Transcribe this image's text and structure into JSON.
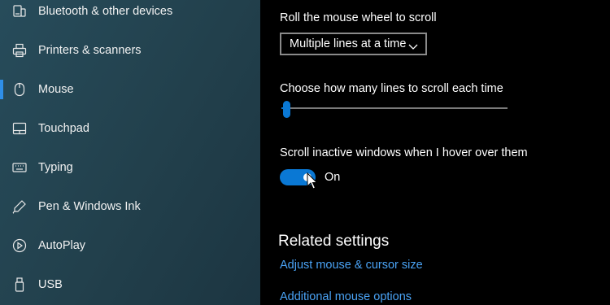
{
  "sidebar": {
    "items": [
      {
        "label": "Bluetooth & other devices",
        "icon": "bluetooth-devices-icon",
        "selected": false
      },
      {
        "label": "Printers & scanners",
        "icon": "printer-icon",
        "selected": false
      },
      {
        "label": "Mouse",
        "icon": "mouse-icon",
        "selected": true
      },
      {
        "label": "Touchpad",
        "icon": "touchpad-icon",
        "selected": false
      },
      {
        "label": "Typing",
        "icon": "keyboard-icon",
        "selected": false
      },
      {
        "label": "Pen & Windows Ink",
        "icon": "pen-icon",
        "selected": false
      },
      {
        "label": "AutoPlay",
        "icon": "autoplay-icon",
        "selected": false
      },
      {
        "label": "USB",
        "icon": "usb-icon",
        "selected": false
      }
    ]
  },
  "main": {
    "scroll_label": "Roll the mouse wheel to scroll",
    "scroll_dropdown_value": "Multiple lines at a time",
    "lines_label": "Choose how many lines to scroll each time",
    "lines_slider_fraction": 0.03,
    "inactive_label": "Scroll inactive windows when I hover over them",
    "inactive_toggle_state": "On",
    "related_heading": "Related settings",
    "link_cursor_size": "Adjust mouse & cursor size",
    "link_additional": "Additional mouse options"
  },
  "colors": {
    "accent": "#0a78d4",
    "link": "#4aa3f5",
    "sidebar_bg": "#24454f",
    "content_bg": "#000000"
  }
}
